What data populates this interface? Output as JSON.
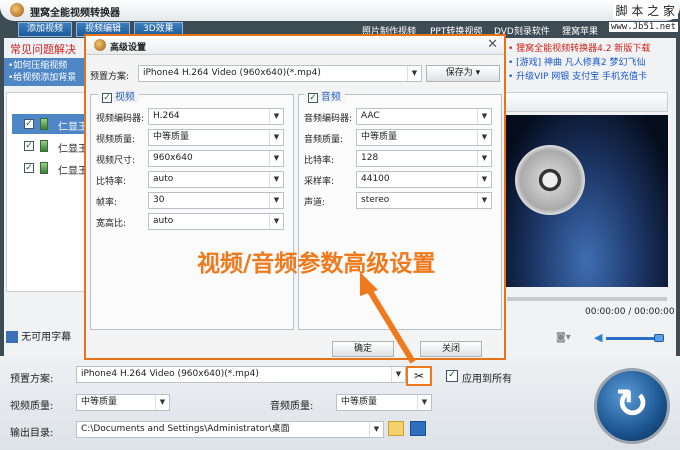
{
  "app": {
    "title": "狸窝全能视频转换器"
  },
  "toolbar": {
    "tabs": [
      "添加视频",
      "视频编辑",
      "3D效果"
    ],
    "links": [
      "照片制作视频",
      "PPT转换视频",
      "DVD刻录软件",
      "狸窝苹果"
    ]
  },
  "watermark": {
    "text": "脚 本 之 家",
    "url": "www.Jb51.net"
  },
  "faq": {
    "title": "常见问题解决",
    "links": [
      "•如何压缩视频",
      "•给视频添加背景"
    ]
  },
  "files": [
    {
      "name": "仁显王"
    },
    {
      "name": "仁显王"
    },
    {
      "name": "仁显王"
    }
  ],
  "subtitle": {
    "label": "无可用字幕"
  },
  "right_links": [
    "• 狸窝全能视频转换器4.2 新版下载",
    "• [游戏] 神曲 凡人修真2 梦幻飞仙",
    "• 升级VIP 网银 支付宝 手机充值卡"
  ],
  "player": {
    "time": "00:00:00 / 00:00:00",
    "volume": 0.9,
    "progress": 0
  },
  "dialog": {
    "title": "高级设置",
    "preset_label": "预置方案:",
    "preset_value": "iPhone4 H.264 Video (960x640)(*.mp4)",
    "save_as": "保存为",
    "video": {
      "title": "视频",
      "checked": true,
      "fields": [
        {
          "label": "视频编码器:",
          "value": "H.264"
        },
        {
          "label": "视频质量:",
          "value": "中等质量"
        },
        {
          "label": "视频尺寸:",
          "value": "960x640"
        },
        {
          "label": "比特率:",
          "value": "auto"
        },
        {
          "label": "帧率:",
          "value": "30"
        },
        {
          "label": "宽高比:",
          "value": "auto"
        }
      ]
    },
    "audio": {
      "title": "音频",
      "checked": true,
      "fields": [
        {
          "label": "音频编码器:",
          "value": "AAC"
        },
        {
          "label": "音频质量:",
          "value": "中等质量"
        },
        {
          "label": "比特率:",
          "value": "128"
        },
        {
          "label": "采样率:",
          "value": "44100"
        },
        {
          "label": "声道:",
          "value": "stereo"
        }
      ]
    },
    "ok": "确定",
    "close": "关闭"
  },
  "annotation": "视频/音频参数高级设置",
  "bottom": {
    "preset_label": "预置方案:",
    "preset_value": "iPhone4 H.264 Video (960x640)(*.mp4)",
    "apply_all": "应用到所有",
    "video_quality_label": "视频质量:",
    "video_quality": "中等质量",
    "audio_quality_label": "音频质量:",
    "audio_quality": "中等质量",
    "output_label": "输出目录:",
    "output_path": "C:\\Documents and Settings\\Administrator\\桌面"
  }
}
